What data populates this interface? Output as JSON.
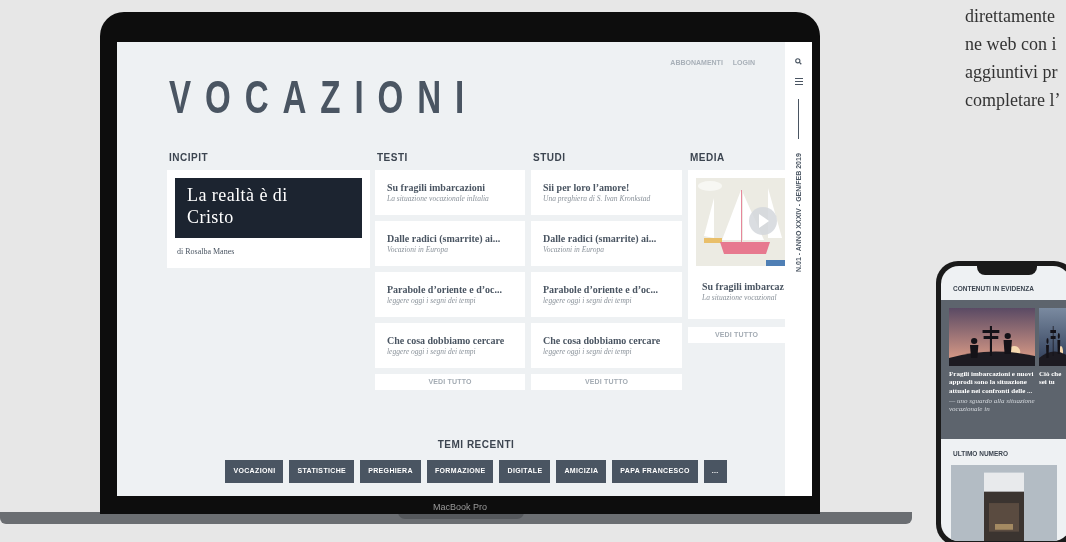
{
  "side_text": {
    "lines": [
      "direttamente",
      "ne web con i",
      "aggiuntivi pr",
      "completare l’"
    ]
  },
  "laptop": {
    "header_links": [
      "ABBONAMENTI",
      "LOGIN"
    ],
    "title": "VOCAZIONI",
    "sidebar": {
      "issue": "N.01 - ANNO XXXIV - GEN/FEB 2019"
    },
    "sections": [
      {
        "kind": "feature",
        "heading": "INCIPIT",
        "title": "La realtà è di Cristo",
        "author": "di Rosalba Manes"
      },
      {
        "kind": "list",
        "heading": "TESTI",
        "items": [
          {
            "title": "Su fragili imbarcazioni",
            "subtitle": "La situazione vocazionale inItalia"
          },
          {
            "title": "Dalle radici (smarrite) ai...",
            "subtitle": "Vocazioni in Europa"
          },
          {
            "title": "Parabole d’oriente e d’oc...",
            "subtitle": "leggere oggi i segni dei tempi"
          },
          {
            "title": "Che cosa dobbiamo cercare",
            "subtitle": "leggere oggi i segni dei tempi"
          }
        ],
        "more": "VEDI TUTTO"
      },
      {
        "kind": "list",
        "heading": "STUDI",
        "items": [
          {
            "title": "Sii per loro l’amore!",
            "subtitle": "Una preghiera di S. Ivan Kronkstad"
          },
          {
            "title": "Dalle radici (smarrite) ai...",
            "subtitle": "Vocazioni in Europa"
          },
          {
            "title": "Parabole d’oriente e d’oc...",
            "subtitle": "leggere oggi i segni dei tempi"
          },
          {
            "title": "Che cosa dobbiamo cercare",
            "subtitle": "leggere oggi i segni dei tempi"
          }
        ],
        "more": "VEDI TUTTO"
      },
      {
        "kind": "media",
        "heading": "MEDIA",
        "items": [
          {
            "title": "Su fragili imbarcaz",
            "subtitle": "La situazione vocazional"
          }
        ],
        "more": "VEDI TUTTO"
      }
    ],
    "topics": {
      "heading": "TEMI RECENTI",
      "tags": [
        "VOCAZIONI",
        "STATISTICHE",
        "PREGHIERA",
        "FORMAZIONE",
        "DIGITALE",
        "AMICIZIA",
        "PAPA FRANCESCO",
        "..."
      ]
    },
    "brand": "MacBook Pro"
  },
  "phone": {
    "featured_heading": "CONTENUTI IN EVIDENZA",
    "cards": [
      {
        "title": "Fragili imbarcazioni e nuovi approdi sono la situazione attuale nei confronti delle ...",
        "subtitle": "— uno sguardo alla situazione vocazionale in"
      },
      {
        "title": "Ciò che sei tu"
      }
    ],
    "issue_heading": "ULTIMO NUMERO"
  }
}
